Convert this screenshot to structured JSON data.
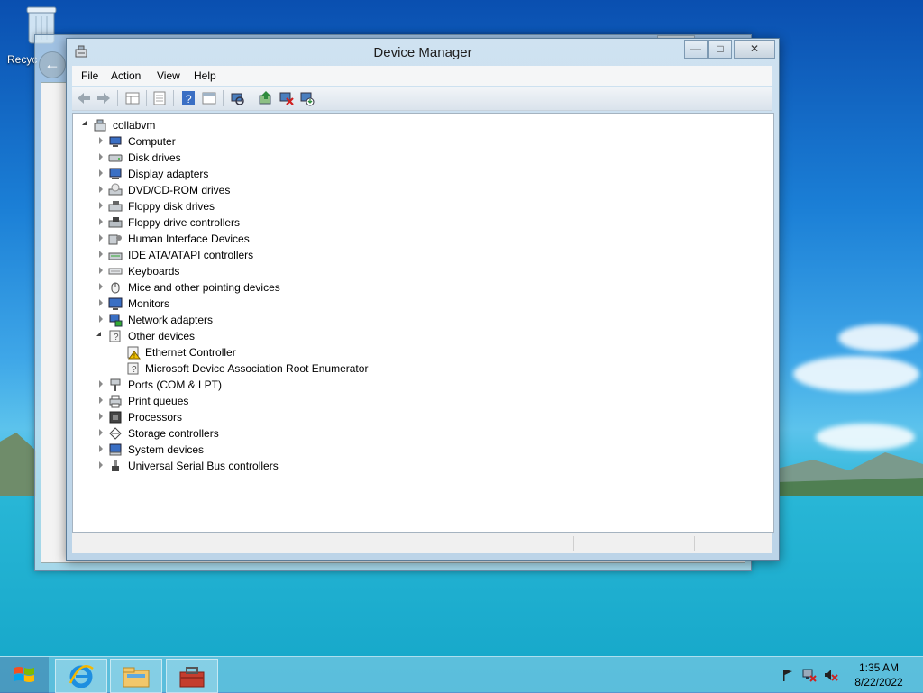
{
  "desktop": {
    "recycle_bin_label": "Recyc"
  },
  "window": {
    "title": "Device Manager",
    "menu": [
      "File",
      "Action",
      "View",
      "Help"
    ],
    "toolbar_icons": [
      "back-icon",
      "forward-icon",
      "properties-grid-icon",
      "show-hide-icon",
      "help-icon",
      "view-icon",
      "scan-icon",
      "update-driver-icon",
      "uninstall-icon",
      "enable-device-icon"
    ]
  },
  "tree": {
    "root": "collabvm",
    "categories": [
      {
        "label": "Computer",
        "icon": "computer-icon"
      },
      {
        "label": "Disk drives",
        "icon": "disk-drive-icon"
      },
      {
        "label": "Display adapters",
        "icon": "display-adapter-icon"
      },
      {
        "label": "DVD/CD-ROM drives",
        "icon": "dvd-icon"
      },
      {
        "label": "Floppy disk drives",
        "icon": "floppy-icon"
      },
      {
        "label": "Floppy drive controllers",
        "icon": "floppy-controller-icon"
      },
      {
        "label": "Human Interface Devices",
        "icon": "hid-icon"
      },
      {
        "label": "IDE ATA/ATAPI controllers",
        "icon": "ide-icon"
      },
      {
        "label": "Keyboards",
        "icon": "keyboard-icon"
      },
      {
        "label": "Mice and other pointing devices",
        "icon": "mouse-icon"
      },
      {
        "label": "Monitors",
        "icon": "monitor-icon"
      },
      {
        "label": "Network adapters",
        "icon": "network-icon"
      },
      {
        "label": "Other devices",
        "icon": "unknown-device-icon",
        "expanded": true,
        "children": [
          {
            "label": "Ethernet Controller",
            "icon": "warning-device-icon"
          },
          {
            "label": "Microsoft Device Association Root Enumerator",
            "icon": "unknown-device-icon"
          }
        ]
      },
      {
        "label": "Ports (COM & LPT)",
        "icon": "port-icon"
      },
      {
        "label": "Print queues",
        "icon": "printer-icon"
      },
      {
        "label": "Processors",
        "icon": "processor-icon"
      },
      {
        "label": "Storage controllers",
        "icon": "storage-icon"
      },
      {
        "label": "System devices",
        "icon": "system-icon"
      },
      {
        "label": "Universal Serial Bus controllers",
        "icon": "usb-icon"
      }
    ]
  },
  "taskbar": {
    "clock_time": "1:35 AM",
    "clock_date": "8/22/2022"
  },
  "colors": {
    "accent": "#3a7fc4",
    "warning": "#f2c200"
  }
}
